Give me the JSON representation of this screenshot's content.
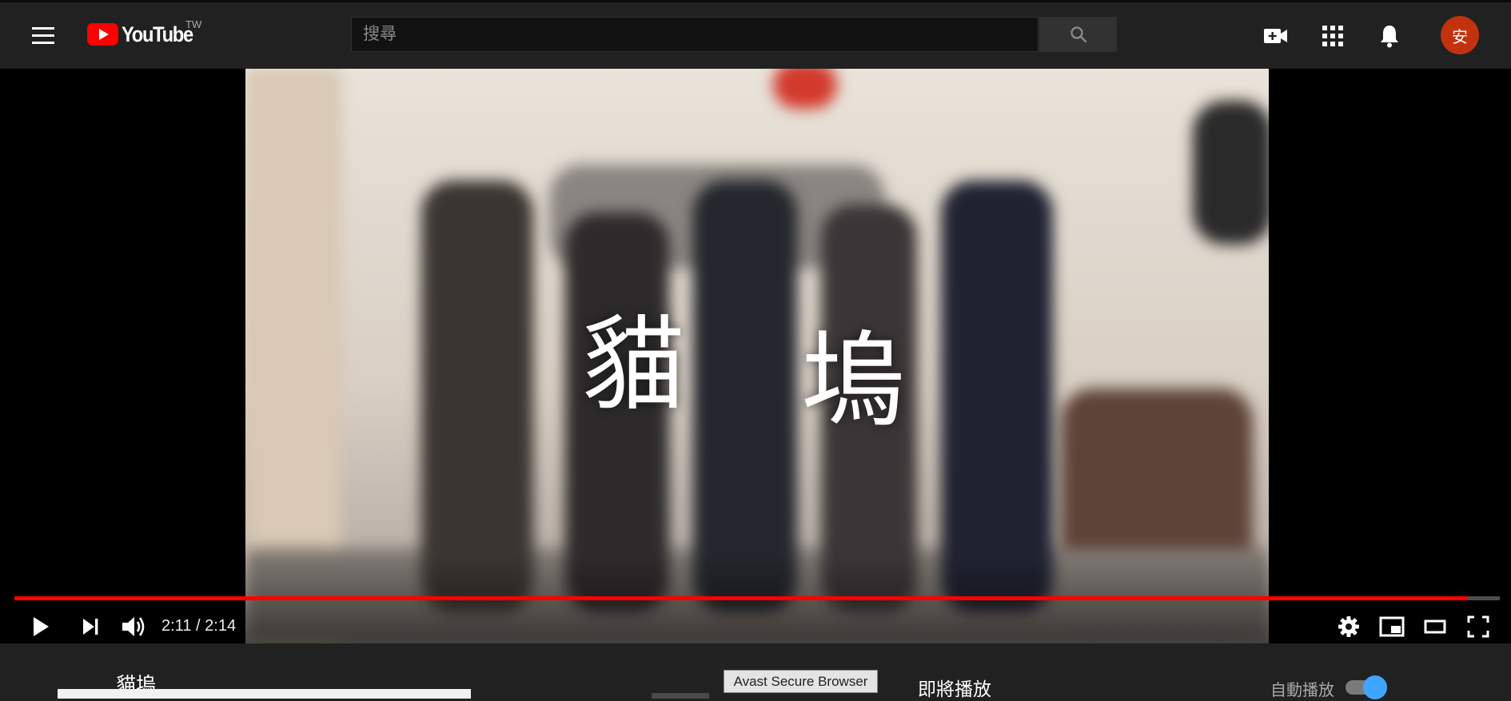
{
  "header": {
    "logo_text": "YouTube",
    "region": "TW",
    "search_placeholder": "搜尋",
    "avatar_initial": "安",
    "icons": [
      "menu-icon",
      "youtube-play-icon",
      "search-icon",
      "create-video-icon",
      "apps-grid-icon",
      "notifications-bell-icon"
    ]
  },
  "player": {
    "caption_left": "貓",
    "caption_right": "塢",
    "current_time": "2:11",
    "separator": "/",
    "duration": "2:14",
    "progress_fraction": 0.978,
    "accent_color": "#ff0000",
    "controls": [
      "play-icon",
      "next-icon",
      "volume-icon",
      "settings-gear-icon",
      "miniplayer-icon",
      "theater-mode-icon",
      "fullscreen-icon"
    ]
  },
  "below": {
    "video_title": "貓塢",
    "tooltip": "Avast Secure Browser",
    "up_next": "即將播放",
    "autoplay_label": "自動播放",
    "autoplay_on": true,
    "toggle_color": "#3ea6ff"
  },
  "colors": {
    "background": "#212121",
    "avatar_bg": "#c2320f",
    "brand_red": "#ff0000"
  }
}
